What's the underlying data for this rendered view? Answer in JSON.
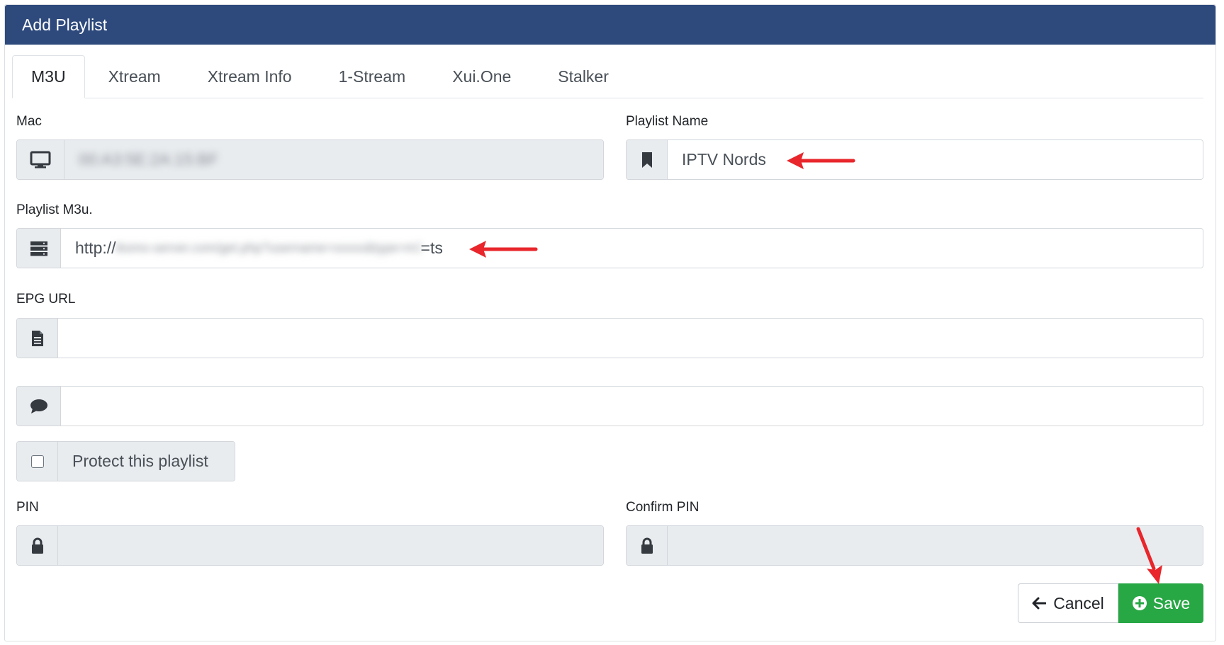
{
  "header": {
    "title": "Add Playlist"
  },
  "tabs": [
    {
      "label": "M3U",
      "active": true
    },
    {
      "label": "Xtream",
      "active": false
    },
    {
      "label": "Xtream Info",
      "active": false
    },
    {
      "label": "1-Stream",
      "active": false
    },
    {
      "label": "Xui.One",
      "active": false
    },
    {
      "label": "Stalker",
      "active": false
    }
  ],
  "form": {
    "mac": {
      "label": "Mac",
      "value": "00:A3:5E:2A:15:BF",
      "icon": "monitor-icon",
      "disabled": true,
      "blurred": true
    },
    "playlist_name": {
      "label": "Playlist Name",
      "value": "IPTV Nords",
      "icon": "bookmark-icon"
    },
    "playlist_m3u": {
      "label": "Playlist M3u.",
      "value_prefix": "http://",
      "value_hidden": "iksmo-server.com/get.php?username=xxxxx&type=m3u_plus&output",
      "value_suffix": "=ts",
      "icon": "server-icon"
    },
    "epg_url": {
      "label": "EPG URL",
      "value": "",
      "icon": "file-icon"
    },
    "note": {
      "value": "",
      "icon": "comment-icon"
    },
    "protect": {
      "label": "Protect this playlist",
      "checked": false
    },
    "pin": {
      "label": "PIN",
      "value": "",
      "icon": "lock-icon",
      "disabled": true
    },
    "confirm_pin": {
      "label": "Confirm PIN",
      "value": "",
      "icon": "lock-icon",
      "disabled": true
    }
  },
  "actions": {
    "cancel_label": "Cancel",
    "save_label": "Save"
  },
  "colors": {
    "header_bg": "#2e4a7c",
    "save_bg": "#28a745",
    "annotation_arrow": "#e8262b"
  }
}
